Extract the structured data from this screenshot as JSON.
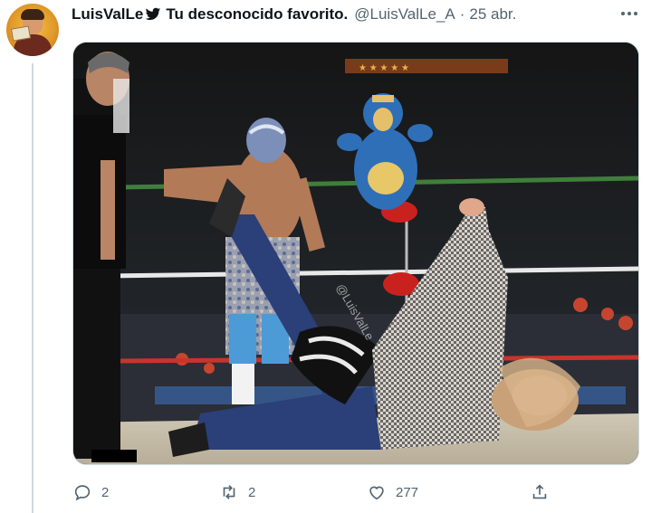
{
  "tweet": {
    "author_name": "LuisValLe",
    "display_name": "Tu desconocido favorito.",
    "handle": "@LuisValLe_A",
    "separator": "·",
    "date": "25 abr.",
    "watermark": "@LuisValLe",
    "media_description_icon": "photo"
  },
  "actions": {
    "reply_count": "2",
    "retweet_count": "2",
    "like_count": "277"
  },
  "colors": {
    "secondary_text": "#536471",
    "border": "#cfd9de",
    "text": "#0f1419"
  },
  "icons": [
    "bird-icon",
    "more-icon",
    "reply-icon",
    "retweet-icon",
    "like-icon",
    "share-icon"
  ]
}
